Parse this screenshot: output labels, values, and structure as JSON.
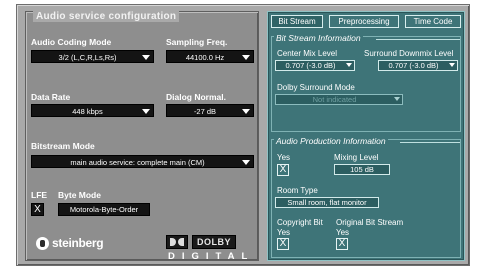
{
  "group_title": "Audio service configuration",
  "left": {
    "audio_coding_mode": {
      "label": "Audio Coding Mode",
      "value": "3/2 (L,C,R,Ls,Rs)"
    },
    "sampling_freq": {
      "label": "Sampling Freq.",
      "value": "44100.0 Hz"
    },
    "data_rate": {
      "label": "Data Rate",
      "value": "448 kbps"
    },
    "dialog_normal": {
      "label": "Dialog Normal.",
      "value": "-27 dB"
    },
    "bitstream_mode": {
      "label": "Bitstream Mode",
      "value": "main audio service: complete main (CM)"
    },
    "lfe": {
      "label": "LFE",
      "checked_mark": "X"
    },
    "byte_mode": {
      "label": "Byte Mode",
      "value": "Motorola-Byte-Order"
    }
  },
  "logos": {
    "steinberg": "steinberg",
    "dolby": "DOLBY",
    "digital": "DIGITAL"
  },
  "tabs": [
    {
      "label": "Bit Stream",
      "active": true
    },
    {
      "label": "Preprocessing",
      "active": false
    },
    {
      "label": "Time Code",
      "active": false
    }
  ],
  "bitstream_info": {
    "title": "Bit Stream Information",
    "center_mix": {
      "label": "Center Mix Level",
      "value": "0.707 (-3.0 dB)"
    },
    "surround_downmix": {
      "label": "Surround Downmix Level",
      "value": "0.707 (-3.0 dB)"
    },
    "dolby_surround": {
      "label": "Dolby Surround Mode",
      "value": "Not indicated"
    }
  },
  "audio_production": {
    "title": "Audio Production Information",
    "yes_label": "Yes",
    "yes_mark": "X",
    "mixing_level": {
      "label": "Mixing Level",
      "value": "105 dB"
    },
    "room_type": {
      "label": "Room Type",
      "value": "Small room, flat monitor"
    },
    "copyright": {
      "label": "Copyright Bit",
      "yes_label": "Yes",
      "mark": "X"
    },
    "original": {
      "label": "Original Bit Stream",
      "yes_label": "Yes",
      "mark": "X"
    }
  },
  "icons": [
    "chevron-down-icon",
    "steinberg-logo-icon",
    "dolby-double-d-icon"
  ]
}
